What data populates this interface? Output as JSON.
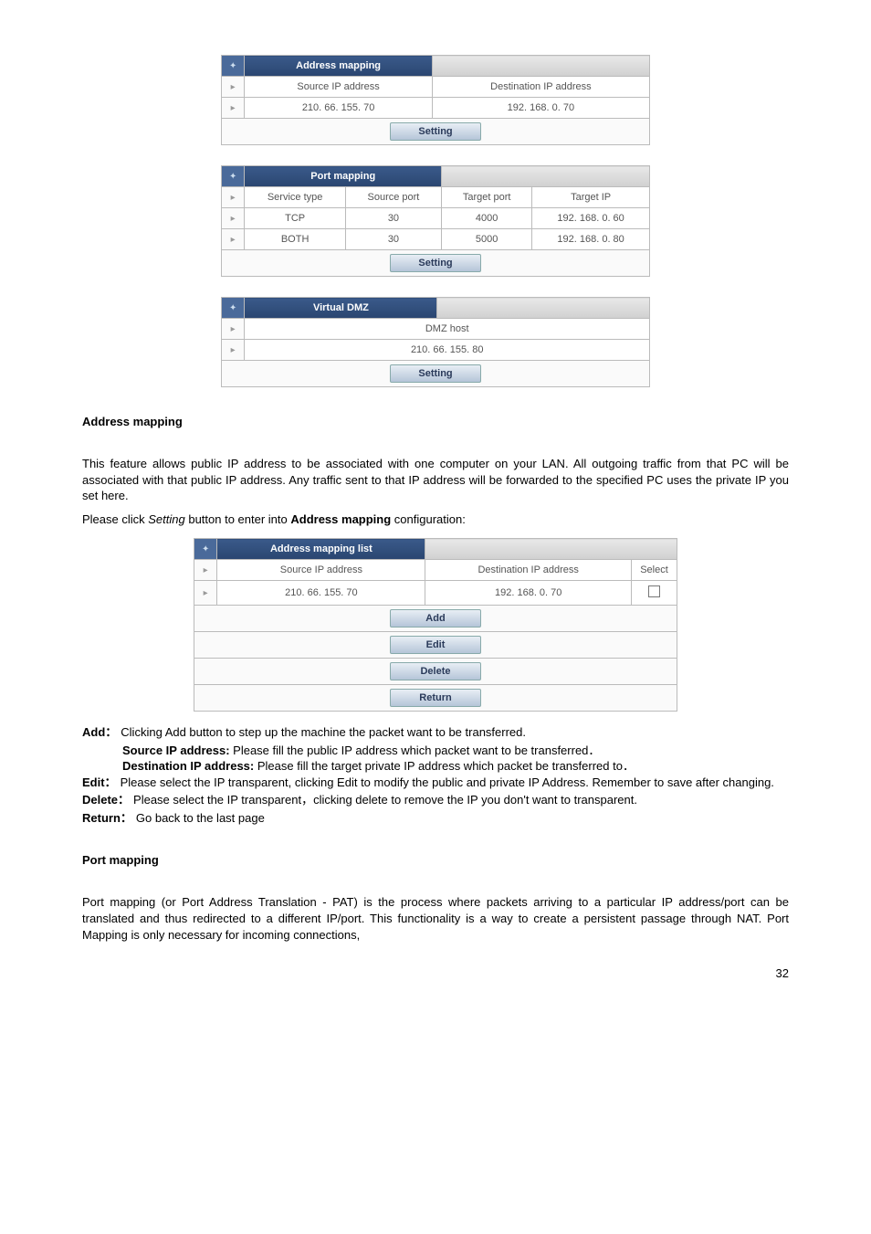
{
  "addressMappingTable": {
    "title": "Address mapping",
    "headers": {
      "src": "Source IP address",
      "dst": "Destination IP address"
    },
    "row": {
      "src": "210. 66. 155. 70",
      "dst": "192. 168. 0. 70"
    },
    "button": "Setting"
  },
  "portMappingTable": {
    "title": "Port mapping",
    "headers": {
      "svc": "Service type",
      "sport": "Source port",
      "tport": "Target port",
      "tip": "Target IP"
    },
    "rows": [
      {
        "svc": "TCP",
        "sport": "30",
        "tport": "4000",
        "tip": "192. 168. 0. 60"
      },
      {
        "svc": "BOTH",
        "sport": "30",
        "tport": "5000",
        "tip": "192. 168. 0. 80"
      }
    ],
    "button": "Setting"
  },
  "virtualDmzTable": {
    "title": "Virtual DMZ",
    "headers": {
      "host": "DMZ host"
    },
    "row": {
      "host": "210. 66. 155. 80"
    },
    "button": "Setting"
  },
  "addressMappingSection": {
    "heading": "Address mapping",
    "p1": "This feature allows public IP address to be associated with one computer on your LAN. All outgoing traffic from that PC will be associated with that public IP address. Any traffic sent to that IP address will be forwarded to the specified PC uses the private IP you set here.",
    "p2_pre": "Please click ",
    "p2_italic": "Setting",
    "p2_mid": " button to enter into ",
    "p2_bold": "Address mapping",
    "p2_post": " configuration:"
  },
  "addressMappingListTable": {
    "title": "Address mapping list",
    "headers": {
      "src": "Source IP address",
      "dst": "Destination IP address",
      "sel": "Select"
    },
    "row": {
      "src": "210. 66. 155. 70",
      "dst": "192. 168. 0. 70"
    },
    "buttons": {
      "add": "Add",
      "edit": "Edit",
      "del": "Delete",
      "ret": "Return"
    }
  },
  "definitions": {
    "add": {
      "term": "Add：",
      "body": "Clicking Add button to step up the machine the packet want to be transferred.",
      "src_label": "Source IP address:",
      "src_body": " Please fill the public IP address which packet want to be transferred．",
      "dst_label": "Destination IP address:",
      "dst_body": " Please fill the target private IP address which packet be transferred to．"
    },
    "edit": {
      "term": "Edit：",
      "body": "Please select the IP transparent, clicking Edit to modify the public and private IP Address. Remember to save after changing."
    },
    "delete": {
      "term": "Delete：",
      "body": "Please select the IP transparent，clicking delete to remove the IP you don't want to transparent."
    },
    "return": {
      "term": "Return：",
      "body": " Go back to the last page"
    }
  },
  "portMappingSection": {
    "heading": "Port mapping",
    "p1": "Port mapping (or Port Address Translation - PAT) is the process where packets arriving to a particular IP address/port can be translated and thus redirected to a different IP/port. This functionality is a way to create a persistent passage through NAT. Port Mapping is only necessary for incoming connections,"
  },
  "pageNumber": "32"
}
